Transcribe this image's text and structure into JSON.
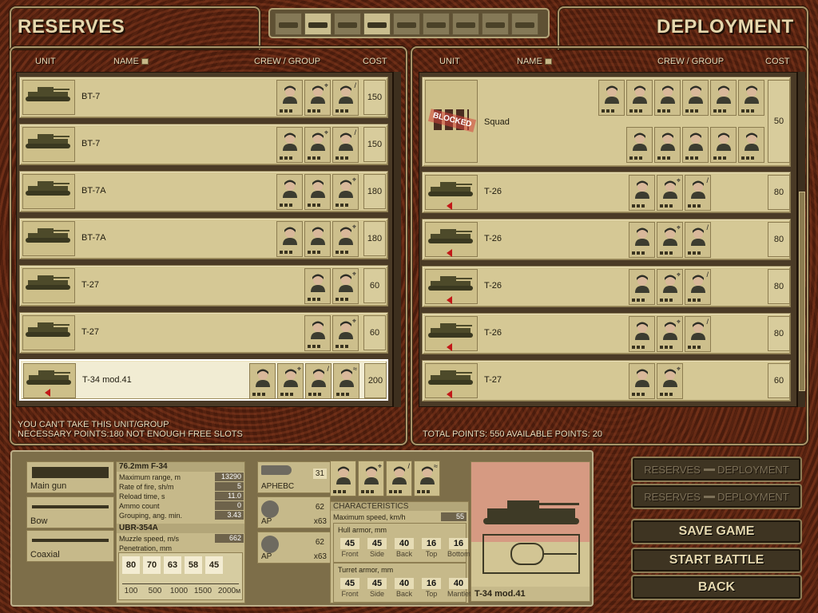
{
  "reserves": {
    "title": "RESERVES",
    "headers": {
      "unit": "UNIT",
      "name": "NAME",
      "crew": "CREW / GROUP",
      "cost": "COST"
    },
    "units": [
      {
        "name": "BT-7",
        "cost": "150",
        "crew": [
          "soldier-icon",
          "gunner-icon",
          "driver-icon"
        ],
        "selected": false
      },
      {
        "name": "BT-7",
        "cost": "150",
        "crew": [
          "soldier-icon",
          "gunner-icon",
          "driver-icon"
        ],
        "selected": false
      },
      {
        "name": "BT-7A",
        "cost": "180",
        "crew": [
          "soldier-icon",
          "soldier-icon",
          "gunner-icon"
        ],
        "selected": false
      },
      {
        "name": "BT-7A",
        "cost": "180",
        "crew": [
          "soldier-icon",
          "soldier-icon",
          "gunner-icon"
        ],
        "selected": false
      },
      {
        "name": "T-27",
        "cost": "60",
        "crew": [
          "soldier-icon",
          "gunner-icon"
        ],
        "selected": false
      },
      {
        "name": "T-27",
        "cost": "60",
        "crew": [
          "soldier-icon",
          "gunner-icon"
        ],
        "selected": false
      },
      {
        "name": "T-34 mod.41",
        "cost": "200",
        "crew": [
          "soldier-icon",
          "gunner-icon",
          "driver-icon",
          "radio-icon"
        ],
        "selected": true
      }
    ],
    "message_line1": "YOU CAN'T TAKE THIS UNIT/GROUP",
    "message_line2": "NECESSARY POINTS:180   NOT ENOUGH FREE SLOTS"
  },
  "deployment": {
    "title": "DEPLOYMENT",
    "headers": {
      "unit": "UNIT",
      "name": "NAME",
      "crew": "CREW / GROUP",
      "cost": "COST"
    },
    "squad": {
      "name": "Squad",
      "cost": "50",
      "stamp": "BLOCKED"
    },
    "units": [
      {
        "name": "T-26",
        "cost": "80"
      },
      {
        "name": "T-26",
        "cost": "80"
      },
      {
        "name": "T-26",
        "cost": "80"
      },
      {
        "name": "T-26",
        "cost": "80"
      },
      {
        "name": "T-27",
        "cost": "60"
      }
    ],
    "footer": "TOTAL POINTS: 550    AVAILABLE POINTS: 20"
  },
  "weapons": {
    "main_gun_label": "Main gun",
    "bow_label": "Bow",
    "coaxial_label": "Coaxial",
    "gun_name": "76.2mm F-34",
    "stats": [
      {
        "label": "Maximum range, m",
        "value": "13290"
      },
      {
        "label": "Rate of fire, sh/m",
        "value": "5"
      },
      {
        "label": "Reload time, s",
        "value": "11.0"
      },
      {
        "label": "Ammo count",
        "value": "0"
      },
      {
        "label": "Grouping, ang. min.",
        "value": "3.43"
      }
    ],
    "shell_name": "UBR-354A",
    "shell_stats": [
      {
        "label": "Muzzle speed, m/s",
        "value": "662"
      },
      {
        "label": "Penetration, mm",
        "value": ""
      }
    ],
    "penetration_values": [
      "80",
      "70",
      "63",
      "58",
      "45"
    ],
    "penetration_ranges": [
      "100",
      "500",
      "1000",
      "1500",
      "2000"
    ],
    "penetration_unit": "м",
    "ammo": [
      {
        "type": "APHEBC",
        "count": "31",
        "mult": ""
      },
      {
        "type": "AP",
        "count": "62",
        "mult": "x63"
      },
      {
        "type": "AP",
        "count": "62",
        "mult": "x63"
      }
    ]
  },
  "characteristics": {
    "title": "CHARACTERISTICS",
    "max_speed_label": "Maximum speed, km/h",
    "max_speed": "55",
    "hull_label": "Hull armor, mm",
    "hull": [
      {
        "label": "Front",
        "value": "45"
      },
      {
        "label": "Side",
        "value": "45"
      },
      {
        "label": "Back",
        "value": "40"
      },
      {
        "label": "Top",
        "value": "16"
      },
      {
        "label": "Bottom",
        "value": "16"
      }
    ],
    "turret_label": "Turret armor, mm",
    "turret": [
      {
        "label": "Front",
        "value": "45"
      },
      {
        "label": "Side",
        "value": "45"
      },
      {
        "label": "Back",
        "value": "40"
      },
      {
        "label": "Top",
        "value": "16"
      },
      {
        "label": "Mantlet",
        "value": "40"
      }
    ],
    "vehicle_name": "T-34 mod.41"
  },
  "buttons": {
    "reserves_word": "RESERVES",
    "deployment_word": "DEPLOYMENT",
    "save": "SAVE GAME",
    "start": "START BATTLE",
    "back": "BACK"
  },
  "filter_tabs": [
    "artillery-icon",
    "tank-icon",
    "truck-icon",
    "infantry-icon",
    "armored-car-icon",
    "apc-icon",
    "aa-gun-icon",
    "supply-icon",
    "howitzer-icon"
  ],
  "colors": {
    "panel_bg": "#d5c895",
    "selected_bg": "#f1ecd3",
    "cost_red": "#c21818",
    "text_light": "#e6d7ad"
  }
}
